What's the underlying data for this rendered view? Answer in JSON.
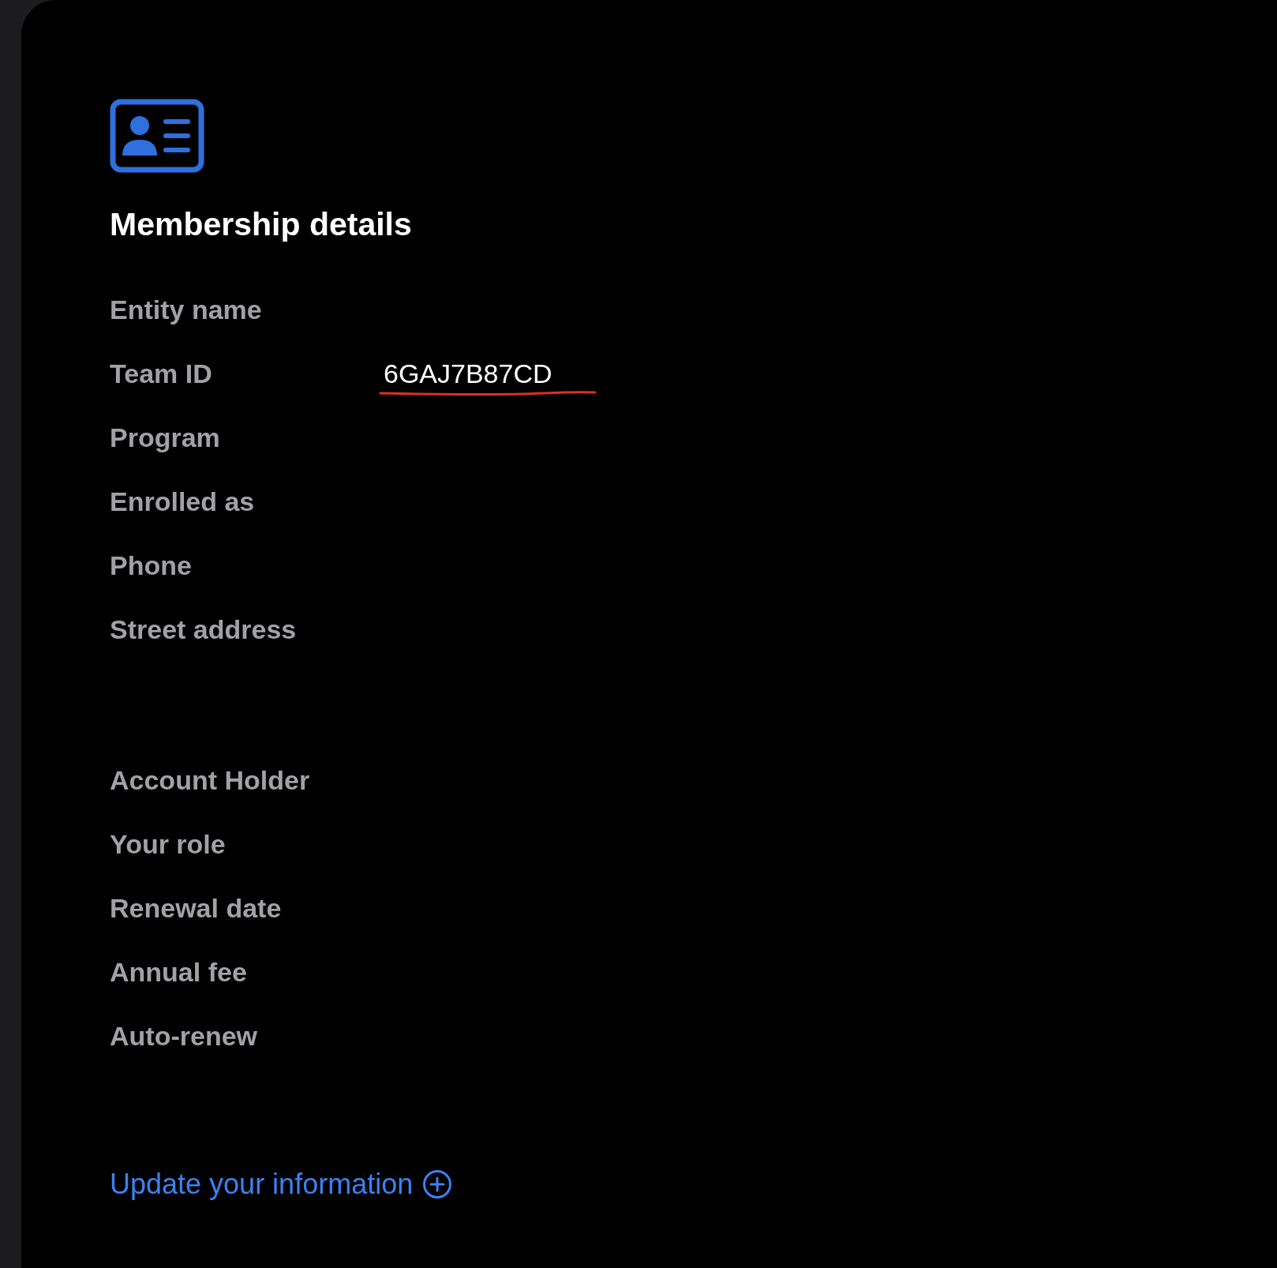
{
  "title": "Membership details",
  "sections": [
    {
      "rows": [
        {
          "label": "Entity name"
        },
        {
          "label": "Team ID",
          "value": "6GAJ7B87CD",
          "underlined": true
        },
        {
          "label": "Program"
        },
        {
          "label": "Enrolled as"
        },
        {
          "label": "Phone"
        },
        {
          "label": "Street address"
        }
      ]
    },
    {
      "rows": [
        {
          "label": "Account Holder"
        },
        {
          "label": "Your role"
        },
        {
          "label": "Renewal date"
        },
        {
          "label": "Annual fee"
        },
        {
          "label": "Auto-renew"
        }
      ]
    }
  ],
  "link": {
    "label": "Update your information"
  }
}
